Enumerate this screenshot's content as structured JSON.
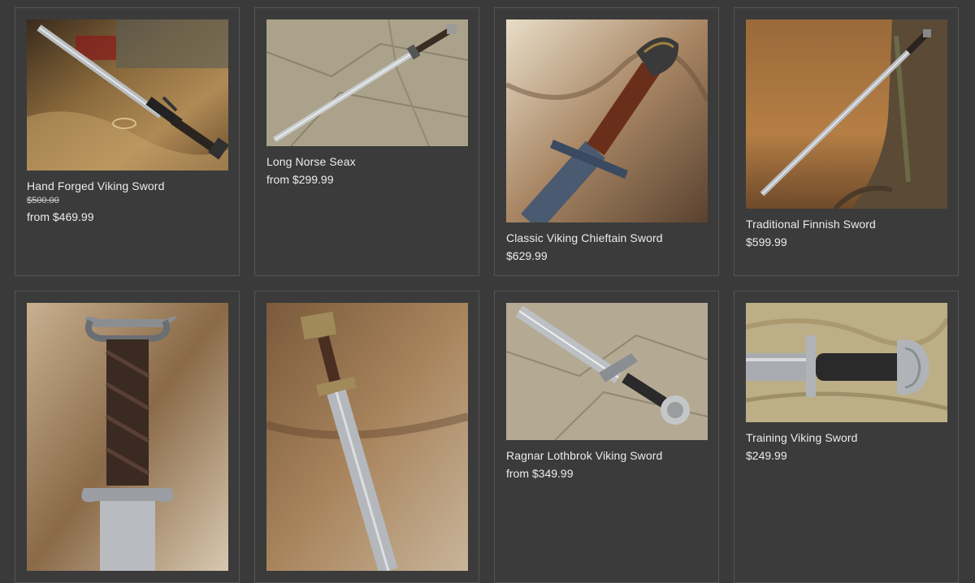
{
  "products": [
    {
      "name": "Hand Forged Viking Sword",
      "old_price": "$500.00",
      "price": "from $469.99",
      "image": "sword-on-fur-with-rings"
    },
    {
      "name": "Long Norse Seax",
      "price": "from $299.99",
      "image": "seax-on-stone"
    },
    {
      "name": "Classic Viking Chieftain Sword",
      "price": "$629.99",
      "image": "sword-hilt-on-fur"
    },
    {
      "name": "Traditional Finnish Sword",
      "price": "$599.99",
      "image": "sword-against-tree"
    },
    {
      "name": "",
      "price": "",
      "image": "sword-hilt-closeup-on-fur"
    },
    {
      "name": "",
      "price": "",
      "image": "sword-on-brown-fur"
    },
    {
      "name": "Ragnar Lothbrok Viking Sword",
      "price": "from $349.99",
      "image": "sword-on-stone"
    },
    {
      "name": "Training Viking Sword",
      "price": "$249.99",
      "image": "training-sword-on-rock"
    }
  ],
  "colors": {
    "background": "#3a3a3a",
    "card_border": "#555555",
    "text": "#ececec"
  }
}
